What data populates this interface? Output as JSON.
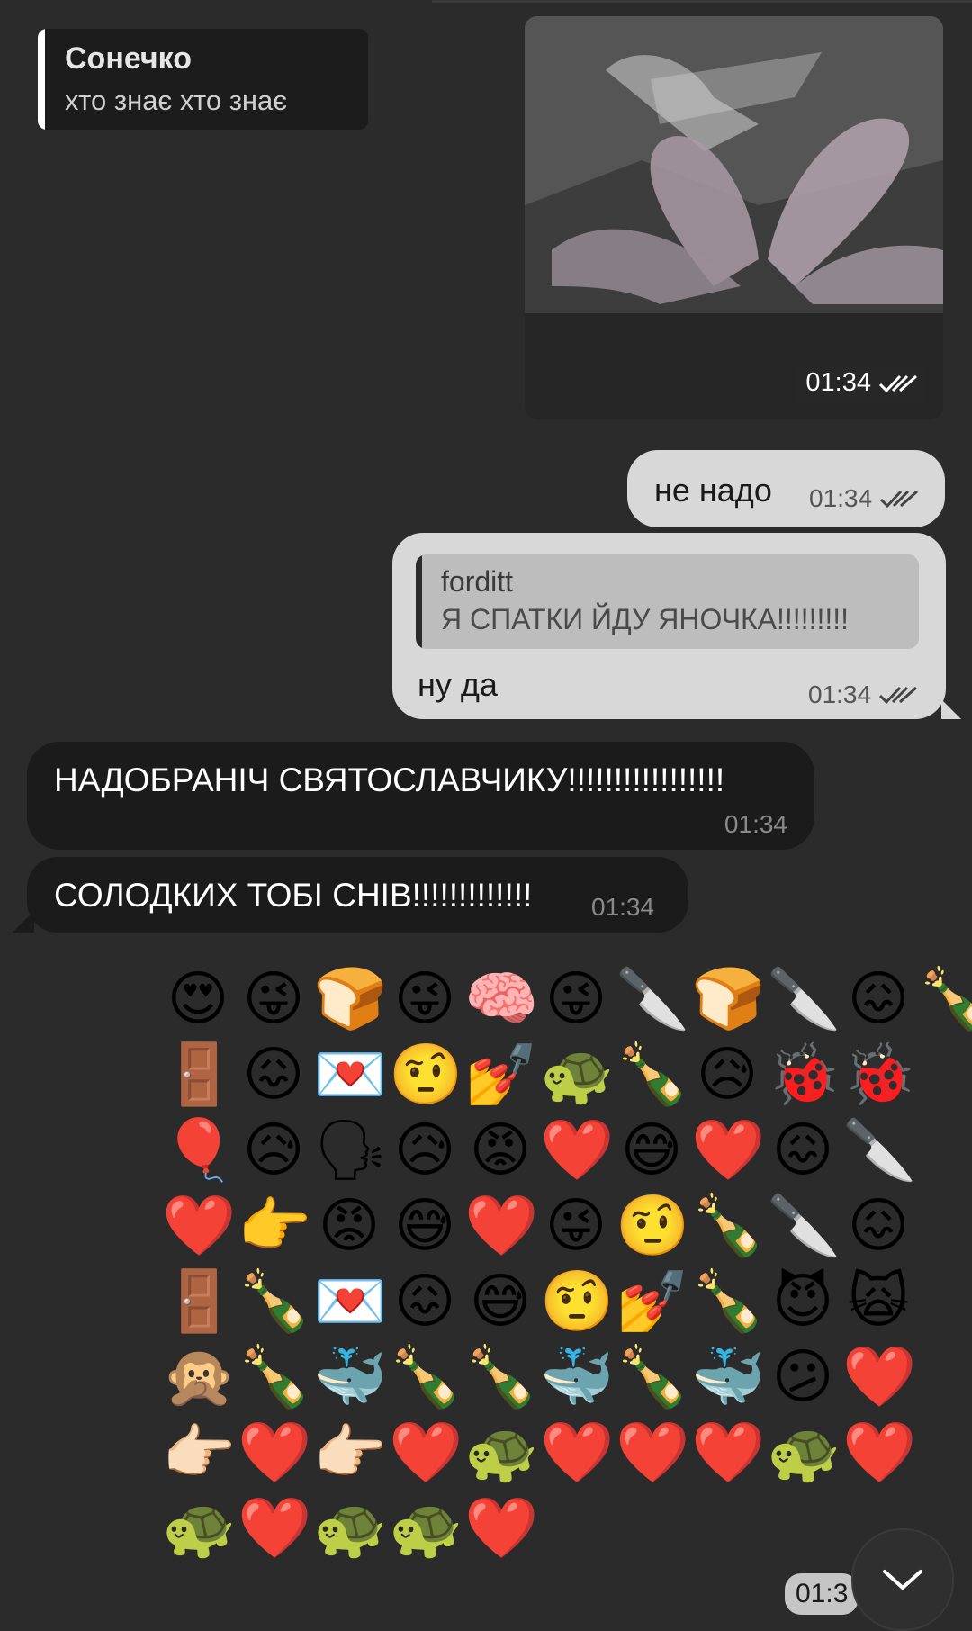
{
  "reply_preview": {
    "name": "Сонечко",
    "text": "хто знає хто знає"
  },
  "photo_message": {
    "time": "01:34",
    "status_icon": "double-check-icon"
  },
  "messages": [
    {
      "direction": "out",
      "text": "не надо",
      "time": "01:34",
      "status_icon": "double-check-icon"
    },
    {
      "direction": "out",
      "reply_name": "forditt",
      "reply_text": "Я СПАТКИ ЙДУ ЯНОЧКА!!!!!!!!!",
      "text": "ну да",
      "time": "01:34",
      "status_icon": "double-check-icon"
    },
    {
      "direction": "in",
      "text": "НАДОБРАНІЧ СВЯТОСЛАВЧИКУ!!!!!!!!!!!!!!!!!",
      "time": "01:34"
    },
    {
      "direction": "in",
      "text": "СОЛОДКИХ ТОБІ СНІВ!!!!!!!!!!!!!",
      "time": "01:34"
    }
  ],
  "emoji_message": {
    "rows": [
      [
        "😍",
        "😜",
        "🍞",
        "😜",
        "🧠",
        "😜",
        "🔪",
        "🍞",
        "🔪",
        "😖",
        "🍾"
      ],
      [
        "🚪",
        "😖",
        "💌",
        "🤨",
        "💅",
        "🐢",
        "🍾",
        "😥",
        "🐞",
        "🐞"
      ],
      [
        "🎈",
        "😥",
        "🗣",
        "😥",
        "😡",
        "❤️",
        "😅",
        "❤️",
        "😖",
        "🔪"
      ],
      [
        "❤️",
        "👉",
        "😡",
        "😅",
        "❤️",
        "😜",
        "🤨",
        "🍾",
        "🔪",
        "😖"
      ],
      [
        "🚪",
        "🍾",
        "💌",
        "😖",
        "😅",
        "🤨",
        "💅",
        "🍾",
        "😈",
        "🙀"
      ],
      [
        "🙊",
        "🍾",
        "🐳",
        "🍾",
        "🍾",
        "🐳",
        "🍾",
        "🐳",
        "😕",
        "❤️"
      ],
      [
        "👉🏻",
        "❤️",
        "👉🏻",
        "❤️",
        "🐢",
        "❤️",
        "❤️",
        "❤️",
        "🐢",
        "❤️"
      ],
      [
        "🐢",
        "❤️",
        "🐢",
        "🐢",
        "❤️"
      ]
    ],
    "time": "01:3"
  },
  "scroll_down_icon": "chevron-down-icon",
  "colors": {
    "background": "#2b2b2b",
    "outgoing_bubble": "#d8d8d8",
    "incoming_bubble": "#1b1b1b"
  }
}
